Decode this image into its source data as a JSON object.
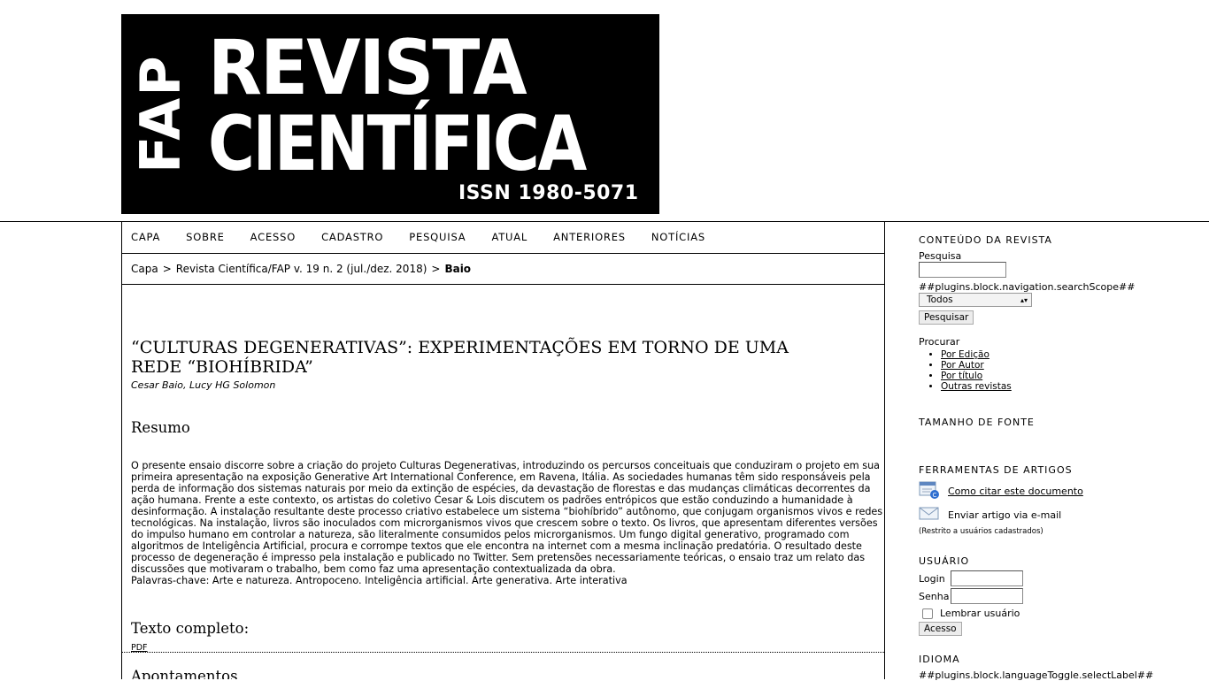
{
  "banner": {
    "vertical": "FAP",
    "line1": "REVISTA",
    "line2": "CIENTÍFICA",
    "issn": "ISSN 1980-5071"
  },
  "nav": [
    "CAPA",
    "SOBRE",
    "ACESSO",
    "CADASTRO",
    "PESQUISA",
    "ATUAL",
    "ANTERIORES",
    "NOTÍCIAS"
  ],
  "breadcrumb": {
    "home": "Capa",
    "issue": "Revista Científica/FAP v. 19 n. 2 (jul./dez. 2018)",
    "current": "Baio",
    "sep": ">"
  },
  "article": {
    "title": "“CULTURAS DEGENERATIVAS”: EXPERIMENTAÇÕES EM TORNO DE UMA REDE “BIOHÍBRIDA”",
    "authors": "Cesar Baio, Lucy HG Solomon",
    "resumo_heading": "Resumo",
    "abstract": "O presente ensaio discorre sobre a criação do projeto Culturas Degenerativas, introduzindo os percursos conceituais que conduziram o projeto em sua primeira apresentação na exposição Generative Art International Conference, em Ravena, Itália. As sociedades humanas têm sido responsáveis pela perda de informação dos sistemas naturais por meio da extinção de espécies, da devastação de florestas e das mudanças climáticas decorrentes da ação humana. Frente a este contexto, os artistas do coletivo Cesar & Lois discutem os padrões entrópicos que estão conduzindo a humanidade à desinformação. A instalação resultante deste processo criativo estabelece um sistema “biohíbrido” autônomo, que conjugam organismos vivos e redes tecnológicas. Na instalação, livros são inoculados com microrganismos vivos que crescem sobre o texto. Os livros, que apresentam diferentes versões do impulso humano em controlar a natureza, são literalmente consumidos pelos microrganismos. Um fungo digital generativo, programado com algoritmos de Inteligência Artificial, procura e corrompe textos que ele encontra na internet com a mesma inclinação predatória. O resultado deste processo de degeneração é impresso pela instalação e publicado no Twitter. Sem pretensões necessariamente teóricas, o ensaio traz um relato das discussões que motivaram o trabalho, bem como faz uma apresentação contextualizada da obra.",
    "keywords": "Palavras-chave: Arte e natureza. Antropoceno. Inteligência artificial. Arte generativa. Arte interativa",
    "fulltext_heading": "Texto completo:",
    "pdf_label": "PDF",
    "apontamentos_heading": "Apontamentos"
  },
  "sidebar": {
    "content_title": "CONTEÚDO DA REVISTA",
    "search_label": "Pesquisa",
    "search_value": "",
    "scope_label": "##plugins.block.navigation.searchScope##",
    "scope_selected": "Todos",
    "search_button": "Pesquisar",
    "browse_label": "Procurar",
    "browse_links": [
      "Por Edição",
      "Por Autor",
      "Por título",
      "Outras revistas"
    ],
    "font_size_title": "TAMANHO DE FONTE",
    "tools_title": "FERRAMENTAS DE ARTIGOS",
    "cite_label": "Como citar este documento",
    "email_label": "Enviar artigo via e-mail",
    "email_note": "(Restrito a usuários cadastrados)",
    "user_title": "USUÁRIO",
    "login_label": "Login",
    "password_label": "Senha",
    "remember_label": "Lembrar usuário",
    "access_button": "Acesso",
    "language_title": "IDIOMA",
    "language_select_label": "##plugins.block.languageToggle.selectLabel##"
  }
}
